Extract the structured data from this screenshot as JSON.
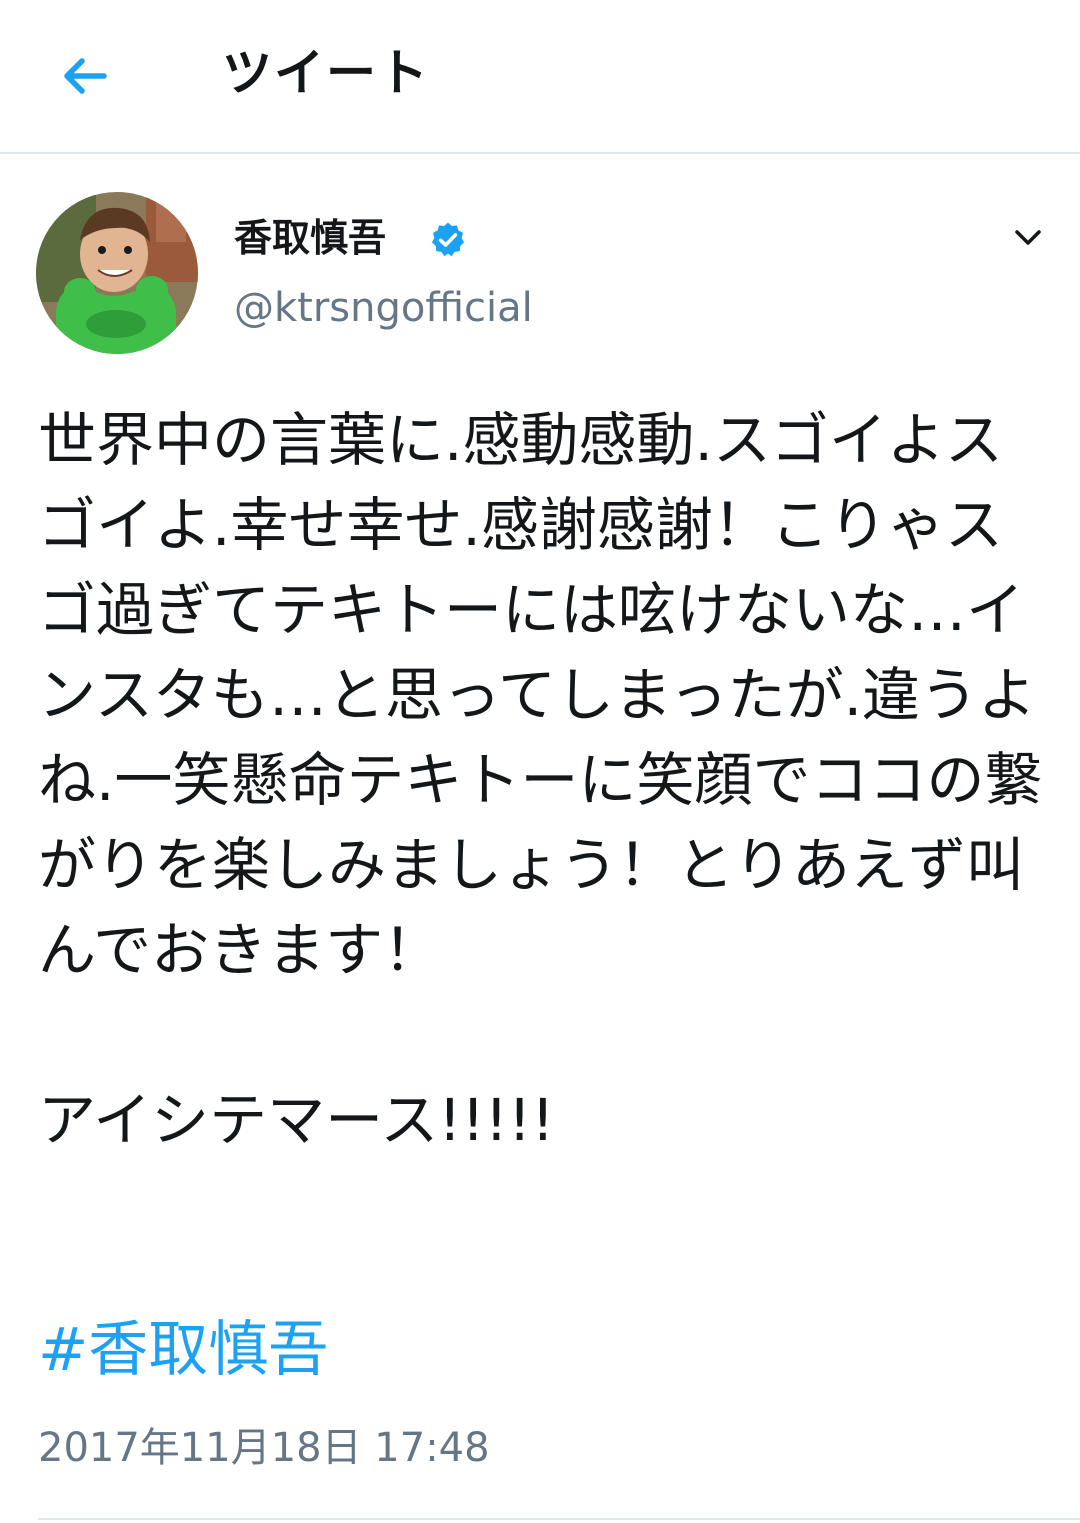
{
  "header": {
    "title": "ツイート",
    "back_icon": "arrow-left-icon"
  },
  "tweet": {
    "author": {
      "display_name": "香取慎吾",
      "handle": "@ktrsngofficial",
      "verified": true
    },
    "body": "世界中の言葉に.感動感動.スゴイよスゴイよ.幸せ幸せ.感謝感謝！こりゃスゴ過ぎてテキトーには呟けないな…インスタも…と思ってしまったが.違うよね.一笑懸命テキトーに笑顔でココの繋がりを楽しみましょう！とりあえず叫んでおきます！\n\nアイシテマース!!!!!",
    "hashtag": "#香取慎吾",
    "timestamp": "2017年11月18日 17:48"
  },
  "colors": {
    "accent": "#1da1f2",
    "text": "#14171a",
    "muted": "#657786",
    "divider": "#e1e8ed"
  }
}
